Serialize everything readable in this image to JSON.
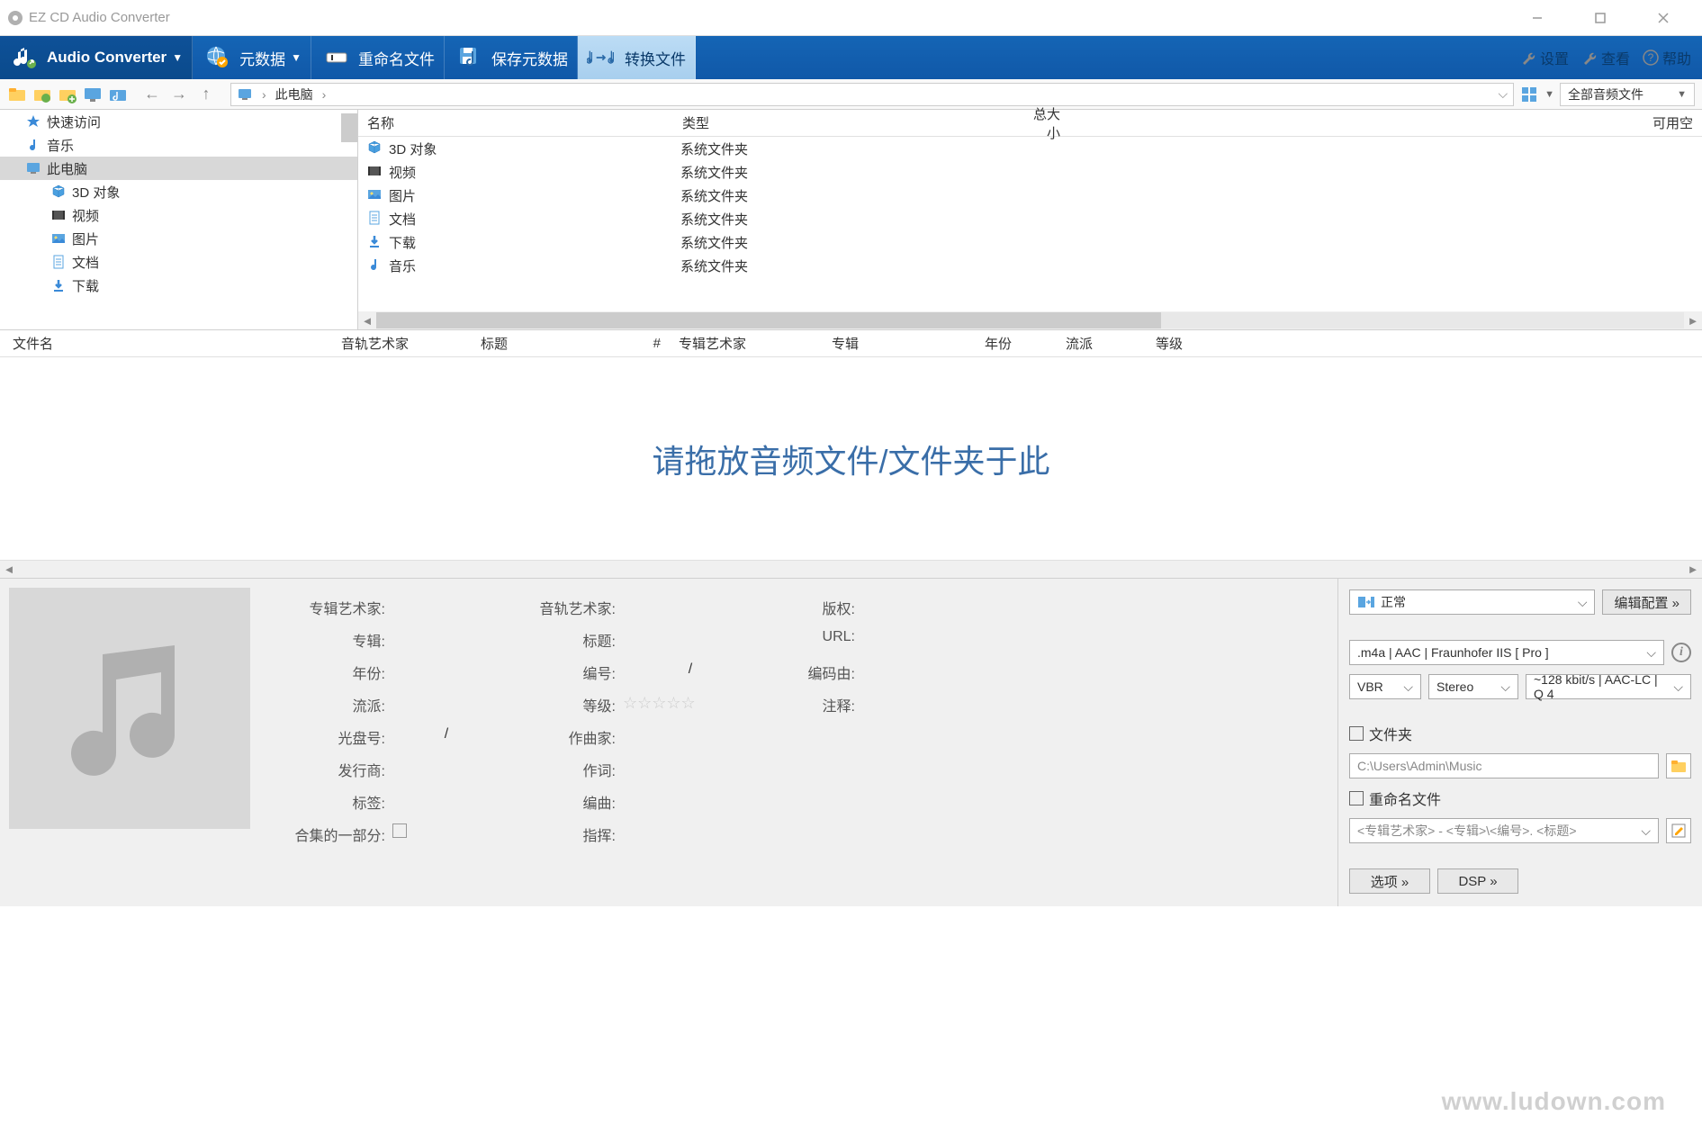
{
  "app": {
    "title": "EZ CD Audio Converter"
  },
  "toolbar": {
    "audio_converter": "Audio Converter",
    "metadata": "元数据",
    "rename_file": "重命名文件",
    "save_metadata": "保存元数据",
    "convert_file": "转换文件",
    "settings": "设置",
    "view": "查看",
    "help": "帮助"
  },
  "nav": {
    "breadcrumb_root": "此电脑",
    "filter": "全部音频文件"
  },
  "tree": {
    "items": [
      {
        "label": "快速访问",
        "icon": "star",
        "selected": false,
        "child": false,
        "color": "#ffa500"
      },
      {
        "label": "音乐",
        "icon": "music",
        "selected": false,
        "child": false,
        "color": "#3a8ad8"
      },
      {
        "label": "此电脑",
        "icon": "pc",
        "selected": true,
        "child": false,
        "color": "#3a8ad8"
      },
      {
        "label": "3D 对象",
        "icon": "cube",
        "selected": false,
        "child": true,
        "color": "#4aa0e0"
      },
      {
        "label": "视频",
        "icon": "video",
        "selected": false,
        "child": true,
        "color": "#555"
      },
      {
        "label": "图片",
        "icon": "image",
        "selected": false,
        "child": true,
        "color": "#5aa5e0"
      },
      {
        "label": "文档",
        "icon": "doc",
        "selected": false,
        "child": true,
        "color": "#5aa5e0"
      },
      {
        "label": "下载",
        "icon": "download",
        "selected": false,
        "child": true,
        "color": "#3a8ad8"
      }
    ]
  },
  "filelist": {
    "cols": {
      "name": "名称",
      "type": "类型",
      "size": "总大小",
      "free": "可用空"
    },
    "rows": [
      {
        "name": "3D 对象",
        "type": "系统文件夹",
        "icon": "cube"
      },
      {
        "name": "视频",
        "type": "系统文件夹",
        "icon": "video"
      },
      {
        "name": "图片",
        "type": "系统文件夹",
        "icon": "image"
      },
      {
        "name": "文档",
        "type": "系统文件夹",
        "icon": "doc"
      },
      {
        "name": "下载",
        "type": "系统文件夹",
        "icon": "download"
      },
      {
        "name": "音乐",
        "type": "系统文件夹",
        "icon": "music"
      }
    ]
  },
  "track_cols": {
    "filename": "文件名",
    "track_artist": "音轨艺术家",
    "title": "标题",
    "num": "#",
    "album_artist": "专辑艺术家",
    "album": "专辑",
    "year": "年份",
    "genre": "流派",
    "rating": "等级"
  },
  "drop_text": "请拖放音频文件/文件夹于此",
  "meta": {
    "album_artist": "专辑艺术家:",
    "album": "专辑:",
    "year": "年份:",
    "genre": "流派:",
    "disc_no": "光盘号:",
    "publisher": "发行商:",
    "tags": "标签:",
    "compilation": "合集的一部分:",
    "track_artist": "音轨艺术家:",
    "title": "标题:",
    "track_no": "编号:",
    "rating": "等级:",
    "composer": "作曲家:",
    "lyricist": "作词:",
    "arranger": "编曲:",
    "conductor": "指挥:",
    "copyright": "版权:",
    "url": "URL:",
    "encoded_by": "编码由:",
    "comment": "注释:",
    "slash": "/"
  },
  "encode": {
    "preset": "正常",
    "edit_config": "编辑配置 »",
    "format": ".m4a  |  AAC  |  Fraunhofer IIS [ Pro ]",
    "mode": "VBR",
    "channels": "Stereo",
    "quality": "~128 kbit/s | AAC-LC | Q 4",
    "folder_chk": "文件夹",
    "folder_path": "C:\\Users\\Admin\\Music",
    "rename_chk": "重命名文件",
    "rename_pattern": "<专辑艺术家> - <专辑>\\<编号>. <标题>",
    "options": "选项 »",
    "dsp": "DSP »"
  },
  "watermark": "www.ludown.com"
}
